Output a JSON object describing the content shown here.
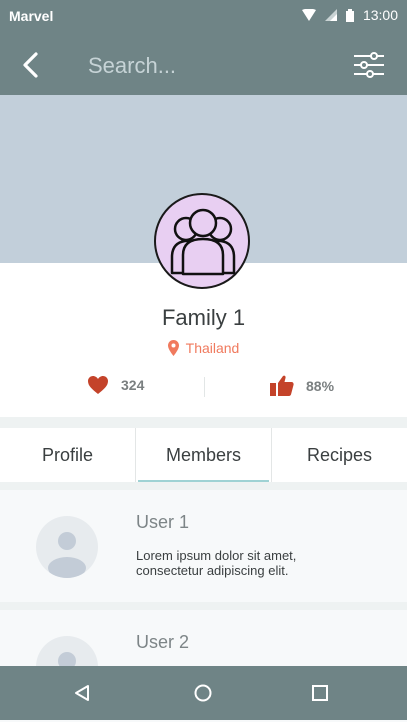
{
  "status": {
    "carrier": "Marvel",
    "time": "13:00"
  },
  "appbar": {
    "search_placeholder": "Search..."
  },
  "profile": {
    "name": "Family 1",
    "location": "Thailand",
    "likes": "324",
    "approval": "88%"
  },
  "tabs": [
    {
      "label": "Profile"
    },
    {
      "label": "Members"
    },
    {
      "label": "Recipes"
    }
  ],
  "members": [
    {
      "name": "User 1",
      "description": "Lorem ipsum dolor sit amet, consectetur adipiscing elit."
    },
    {
      "name": "User 2",
      "description": ""
    }
  ],
  "colors": {
    "bar": "#6f8486",
    "accent": "#f07a5e",
    "heart": "#c4432a",
    "cover": "#c2cfda",
    "avatar_bg": "#e8cff2",
    "tab_indicator": "#9fd2d4"
  }
}
